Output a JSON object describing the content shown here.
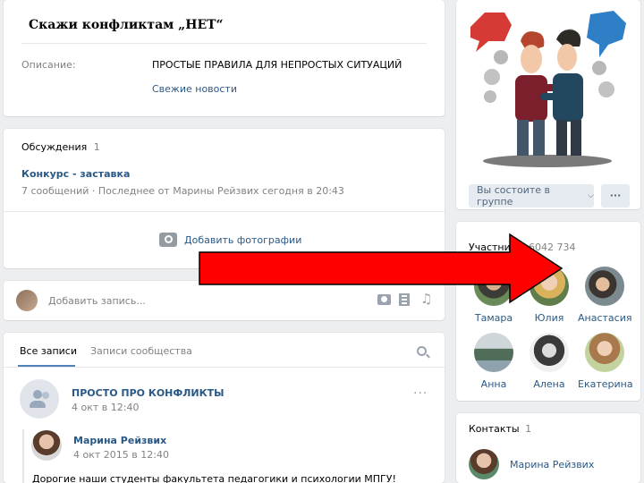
{
  "group": {
    "title": "Скажи конфликтам „НЕТ“",
    "description_label": "Описание:",
    "description_value": "ПРОСТЫЕ ПРАВИЛА ДЛЯ НЕПРОСТЫХ СИТУАЦИЙ",
    "fresh_news": "Свежие новости"
  },
  "discussions": {
    "label": "Обсуждения",
    "count": "1",
    "topic_title": "Конкурс - заставка",
    "topic_meta": "7 сообщений · Последнее от Марины Рейзвих сегодня в 20:43"
  },
  "photos": {
    "add_label": "Добавить фотографии"
  },
  "composer": {
    "placeholder": "Добавить запись..."
  },
  "feed": {
    "tabs": [
      "Все записи",
      "Записи сообщества"
    ],
    "post": {
      "author": "ПРОСТО ПРО КОНФЛИКТЫ",
      "time": "4 окт в 12:40",
      "repost_author": "Марина Рейзвих",
      "repost_time": "4 окт 2015 в 12:40",
      "text": "Дорогие наши студенты факультета педагогики и психологии МПГУ!"
    }
  },
  "sidebar": {
    "member_button": "Вы состоите в группе",
    "more_button": "···",
    "members_label": "Участники",
    "members_count": "6042 734",
    "members": [
      {
        "name": "Тамара"
      },
      {
        "name": "Юлия"
      },
      {
        "name": "Анастасия"
      },
      {
        "name": "Анна"
      },
      {
        "name": "Алена"
      },
      {
        "name": "Екатерина"
      }
    ],
    "contacts_label": "Контакты",
    "contacts_count": "1",
    "contact_name": "Марина Рейзвих"
  },
  "colors": {
    "background": "#edeef0",
    "link": "#2a5885",
    "arrow": "#ff0000",
    "button_bg": "#e5ebf1"
  }
}
